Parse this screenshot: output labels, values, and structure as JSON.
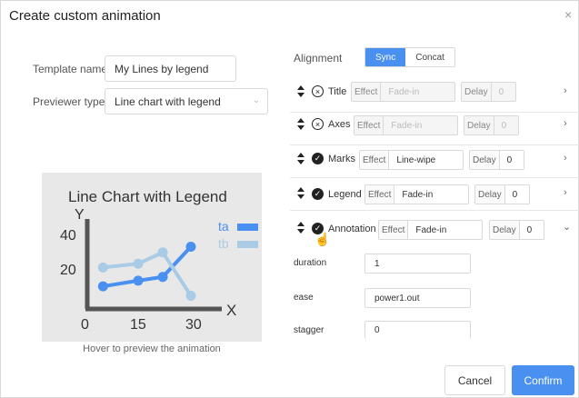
{
  "dialog": {
    "title": "Create custom animation",
    "close_glyph": "×"
  },
  "form": {
    "template_name_label": "Template name",
    "template_name_value": "My Lines by legend",
    "previewer_type_label": "Previewer type",
    "previewer_type_value": "Line chart with legend"
  },
  "preview": {
    "hover_text": "Hover to preview the animation",
    "chart_title": "Line Chart with Legend",
    "y_axis_label": "Y",
    "x_axis_label": "X",
    "y_ticks": [
      "40",
      "20"
    ],
    "x_ticks": [
      "0",
      "15",
      "30"
    ],
    "legend": [
      "ta",
      "tb"
    ]
  },
  "chart_data": {
    "type": "line",
    "title": "Line Chart with Legend",
    "xlabel": "X",
    "ylabel": "Y",
    "series": [
      {
        "name": "ta",
        "color": "#4a90f0",
        "x": [
          5,
          15,
          22,
          30
        ],
        "y": [
          12,
          15,
          17,
          33
        ]
      },
      {
        "name": "tb",
        "color": "#a9cbe6",
        "x": [
          5,
          15,
          22,
          30
        ],
        "y": [
          22,
          24,
          30,
          7
        ]
      }
    ]
  },
  "alignment": {
    "label": "Alignment",
    "options": [
      "Sync",
      "Concat"
    ],
    "selected": "Sync"
  },
  "rows": [
    {
      "label": "Title",
      "enabled": false,
      "effect_prefix": "Effect",
      "effect": "Fade-in",
      "delay_prefix": "Delay",
      "delay": "0"
    },
    {
      "label": "Axes",
      "enabled": false,
      "effect_prefix": "Effect",
      "effect": "Fade-in",
      "delay_prefix": "Delay",
      "delay": "0"
    },
    {
      "label": "Marks",
      "enabled": true,
      "effect_prefix": "Effect",
      "effect": "Line-wipe",
      "delay_prefix": "Delay",
      "delay": "0"
    },
    {
      "label": "Legend",
      "enabled": true,
      "effect_prefix": "Effect",
      "effect": "Fade-in",
      "delay_prefix": "Delay",
      "delay": "0"
    },
    {
      "label": "Annotation",
      "enabled": true,
      "effect_prefix": "Effect",
      "effect": "Fade-in",
      "delay_prefix": "Delay",
      "delay": "0"
    }
  ],
  "annotation_params": [
    {
      "label": "duration",
      "value": "1"
    },
    {
      "label": "ease",
      "value": "power1.out"
    },
    {
      "label": "stagger",
      "value": "0"
    }
  ],
  "icons": {
    "off": "×",
    "on": "✓",
    "chevron_right": "›",
    "chevron_down": "⌄"
  },
  "buttons": {
    "cancel": "Cancel",
    "confirm": "Confirm"
  },
  "colors": {
    "accent": "#4a90f0",
    "series_a": "#4a90f0",
    "series_b": "#a9cbe6"
  }
}
